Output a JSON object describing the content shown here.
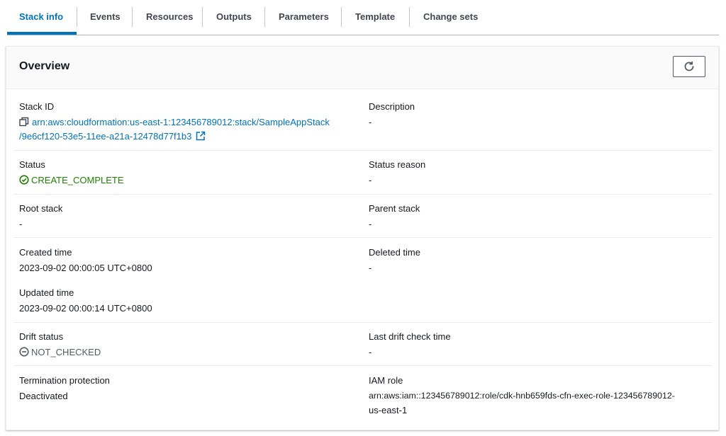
{
  "tabs": [
    {
      "label": "Stack info",
      "active": true
    },
    {
      "label": "Events"
    },
    {
      "label": "Resources"
    },
    {
      "label": "Outputs"
    },
    {
      "label": "Parameters"
    },
    {
      "label": "Template"
    },
    {
      "label": "Change sets"
    }
  ],
  "overview": {
    "title": "Overview",
    "refresh_icon": "refresh-icon",
    "stack_id": {
      "label": "Stack ID",
      "value_line1": "arn:aws:cloudformation:us-east-1:123456789012:stack/SampleAppStack",
      "value_line2": "/9e6cf120-53e5-11ee-a21a-12478d77f1b3",
      "copy_icon": "copy-icon",
      "external_icon": "external-link-icon"
    },
    "description": {
      "label": "Description",
      "value": "-"
    },
    "status": {
      "label": "Status",
      "value": "CREATE_COMPLETE",
      "icon": "check-circle-icon",
      "color": "#1d8102"
    },
    "status_reason": {
      "label": "Status reason",
      "value": "-"
    },
    "root_stack": {
      "label": "Root stack",
      "value": "-"
    },
    "parent_stack": {
      "label": "Parent stack",
      "value": "-"
    },
    "created_time": {
      "label": "Created time",
      "value": "2023-09-02 00:00:05 UTC+0800"
    },
    "deleted_time": {
      "label": "Deleted time",
      "value": "-"
    },
    "updated_time": {
      "label": "Updated time",
      "value": "2023-09-02 00:00:14 UTC+0800"
    },
    "drift_status": {
      "label": "Drift status",
      "value": "NOT_CHECKED",
      "icon": "minus-circle-icon"
    },
    "last_drift_check": {
      "label": "Last drift check time",
      "value": "-"
    },
    "termination_protection": {
      "label": "Termination protection",
      "value": "Deactivated"
    },
    "iam_role": {
      "label": "IAM role",
      "value_line1": "arn:aws:iam::123456789012:role/cdk-hnb659fds-cfn-exec-role-123456789012-",
      "value_line2": "us-east-1"
    }
  },
  "colors": {
    "accent": "#0073bb",
    "success": "#1d8102",
    "text": "#16191f",
    "muted": "#545b64"
  }
}
